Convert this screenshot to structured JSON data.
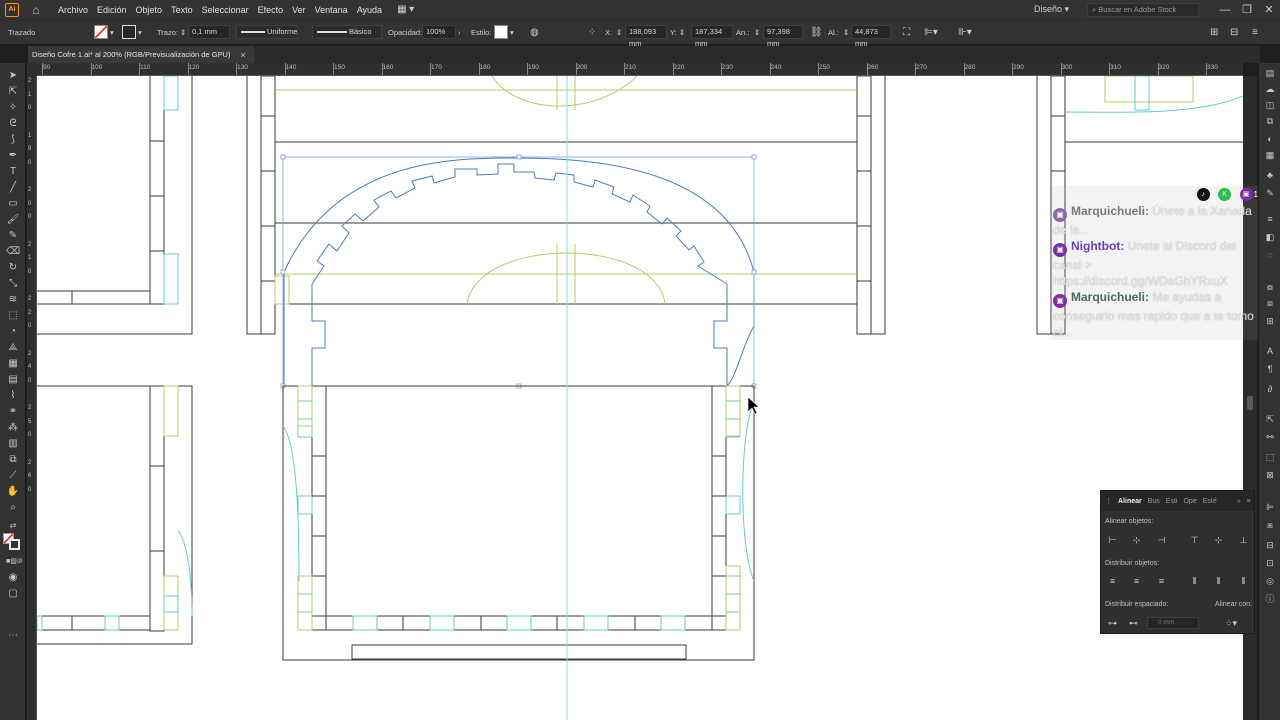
{
  "app": {
    "logo_text": "Ai"
  },
  "menu": {
    "items": [
      "Archivo",
      "Edición",
      "Objeto",
      "Texto",
      "Seleccionar",
      "Efecto",
      "Ver",
      "Ventana",
      "Ayuda"
    ],
    "workspace": "Diseño",
    "stock_search_placeholder": "Buscar en Adobe Stock"
  },
  "controlbar": {
    "selection_label": "Trazado",
    "stroke_label": "Trazo:",
    "stroke_weight": "0,1 mm",
    "profile_label": "Uniforme",
    "brush_label": "Básico",
    "opacity_label": "Opacidad:",
    "opacity_value": "100%",
    "style_label": "Estilo:",
    "x_label": "X:",
    "x_value": "188,093 mm",
    "y_label": "Y:",
    "y_value": "187,334 mm",
    "w_label": "An.:",
    "w_value": "97,398 mm",
    "h_label": "Al.:",
    "h_value": "44,873 mm"
  },
  "document_tab": {
    "title": "Diseño Cofre 1.ai* al 200% (RGB/Previsualización de GPU)",
    "close": "×"
  },
  "ruler": {
    "top_labels": [
      "90",
      "100",
      "110",
      "120",
      "130",
      "140",
      "150",
      "160",
      "170",
      "180",
      "190",
      "200",
      "210",
      "220",
      "230",
      "240",
      "250",
      "260",
      "270",
      "280",
      "290",
      "300",
      "310",
      "320",
      "330",
      "340"
    ],
    "left_labels": [
      "2",
      "1",
      "0",
      "1",
      "9",
      "0",
      "2",
      "0",
      "0",
      "2",
      "1",
      "0",
      "2",
      "2",
      "0",
      "2",
      "4",
      "0",
      "2",
      "5",
      "0",
      "2",
      "6",
      "0"
    ]
  },
  "chat": {
    "counts": [
      "1",
      "2",
      "1"
    ],
    "messages": [
      {
        "user": "Marquichueli:",
        "user_color": "#7a7a7a",
        "text": "Únete a la Xanada de la..."
      },
      {
        "user": "Nightbot:",
        "user_color": "#6a3fb5",
        "text": "Unete al Discord del canal > https://discord.gg/WDaGhYRxuX"
      },
      {
        "user": "Marquichueli:",
        "user_color": "#4a6a5a",
        "text": "Me ayudas a conseguirlo mas rapido que a te tomo el..."
      }
    ]
  },
  "align_panel": {
    "tabs": [
      "Alinear",
      "Bus",
      "Esti",
      "Ope",
      "Esté"
    ],
    "align_label": "Alinear objetos:",
    "distribute_label": "Distribuir objetos:",
    "spacing_label": "Distribuir espaciado:",
    "align_to_label": "Alinear con:",
    "spacing_value": "0 mm"
  },
  "colors": {
    "accent": "#ff9a00",
    "selection": "#4a7cc4",
    "guide_cyan": "#66cccc",
    "guide_green": "#b8cc66",
    "outline": "#3a3a3a"
  }
}
